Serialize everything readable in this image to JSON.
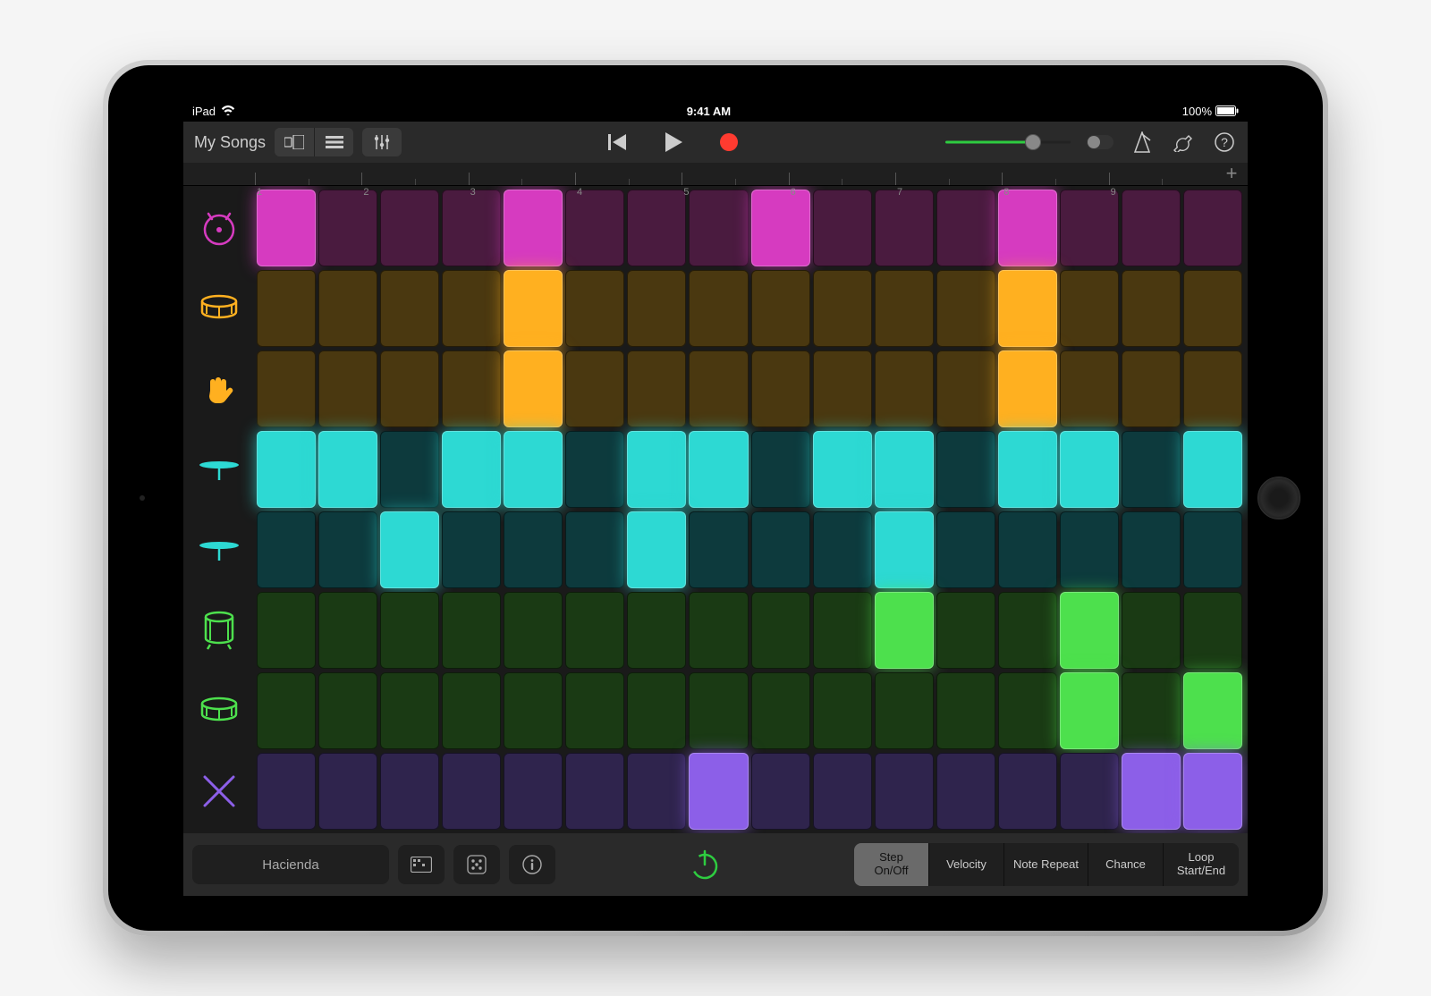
{
  "status": {
    "device": "iPad",
    "time": "9:41 AM",
    "battery_pct": "100%"
  },
  "toolbar": {
    "my_songs": "My Songs"
  },
  "ruler": {
    "labels": [
      "1",
      "2",
      "3",
      "4",
      "5",
      "6",
      "7",
      "8",
      "9"
    ],
    "add_glyph": "+"
  },
  "tracks": [
    {
      "id": "kick",
      "name": "kick-drum-icon",
      "color_row": "row-magenta",
      "icon_key": "kick",
      "icon_color": "#d63bc0"
    },
    {
      "id": "snare",
      "name": "snare-drum-icon",
      "color_row": "row-amber",
      "icon_key": "snare",
      "icon_color": "#ffb020"
    },
    {
      "id": "clap",
      "name": "clap-icon",
      "color_row": "row-amber",
      "icon_key": "hand",
      "icon_color": "#ffb020"
    },
    {
      "id": "hihat",
      "name": "hihat-icon",
      "color_row": "row-cyan",
      "icon_key": "cymbal",
      "icon_color": "#2dd9d3"
    },
    {
      "id": "hihat2",
      "name": "open-hihat-icon",
      "color_row": "row-cyan",
      "icon_key": "cymbal",
      "icon_color": "#2dd9d3"
    },
    {
      "id": "tom1",
      "name": "floor-tom-icon",
      "color_row": "row-green",
      "icon_key": "tom",
      "icon_color": "#4de04d"
    },
    {
      "id": "tom2",
      "name": "tom-icon",
      "color_row": "row-green",
      "icon_key": "snare",
      "icon_color": "#4de04d"
    },
    {
      "id": "sticks",
      "name": "sticks-icon",
      "color_row": "row-purple",
      "icon_key": "sticks",
      "icon_color": "#8c5fe8"
    }
  ],
  "grid": {
    "columns": 16,
    "steps": [
      [
        1,
        0,
        0,
        0,
        1,
        0,
        0,
        0,
        1,
        0,
        0,
        0,
        1,
        0,
        0,
        0
      ],
      [
        0,
        0,
        0,
        0,
        1,
        0,
        0,
        0,
        0,
        0,
        0,
        0,
        1,
        0,
        0,
        0
      ],
      [
        0,
        0,
        0,
        0,
        1,
        0,
        0,
        0,
        0,
        0,
        0,
        0,
        1,
        0,
        0,
        0
      ],
      [
        1,
        1,
        0,
        1,
        1,
        0,
        1,
        1,
        0,
        1,
        1,
        0,
        1,
        1,
        0,
        1
      ],
      [
        0,
        0,
        1,
        0,
        0,
        0,
        1,
        0,
        0,
        0,
        1,
        0,
        0,
        0,
        0,
        0
      ],
      [
        0,
        0,
        0,
        0,
        0,
        0,
        0,
        0,
        0,
        0,
        1,
        0,
        0,
        1,
        0,
        0
      ],
      [
        0,
        0,
        0,
        0,
        0,
        0,
        0,
        0,
        0,
        0,
        0,
        0,
        0,
        1,
        0,
        1
      ],
      [
        0,
        0,
        0,
        0,
        0,
        0,
        0,
        1,
        0,
        0,
        0,
        0,
        0,
        0,
        1,
        1
      ]
    ]
  },
  "bottom": {
    "preset": "Hacienda",
    "modes": [
      {
        "label1": "Step",
        "label2": "On/Off",
        "on": true
      },
      {
        "label1": "Velocity",
        "label2": "",
        "on": false
      },
      {
        "label1": "Note Repeat",
        "label2": "",
        "on": false
      },
      {
        "label1": "Chance",
        "label2": "",
        "on": false
      },
      {
        "label1": "Loop",
        "label2": "Start/End",
        "on": false
      }
    ]
  }
}
